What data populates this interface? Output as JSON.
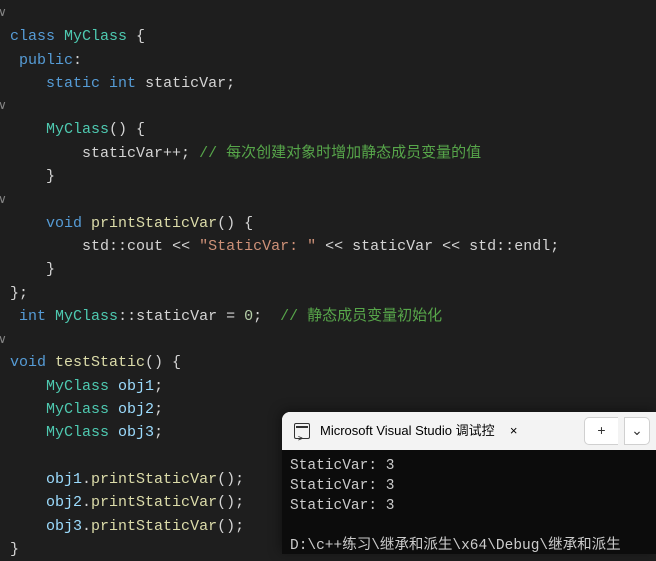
{
  "code": {
    "l1_kw1": "class",
    "l1_type": "MyClass",
    "l1_brace": " {",
    "l2_kw": "public",
    "l2_colon": ":",
    "l3_kw1": "static",
    "l3_kw2": "int",
    "l3_var": "staticVar",
    "l3_semi": ";",
    "l5_type": "MyClass",
    "l5_parens": "() {",
    "l6_var": "staticVar",
    "l6_op": "++;",
    "l6_cmt": "// 每次创建对象时增加静态成员变量的值",
    "l7_brace": "}",
    "l9_kw": "void",
    "l9_fn": "printStaticVar",
    "l9_parens": "() {",
    "l10_ns": "std",
    "l10_scope1": "::",
    "l10_cout": "cout",
    "l10_op1": " << ",
    "l10_str": "\"StaticVar: \"",
    "l10_op2": " << ",
    "l10_var": "staticVar",
    "l10_op3": " << ",
    "l10_ns2": "std",
    "l10_scope2": "::",
    "l10_endl": "endl",
    "l10_semi": ";",
    "l11_brace": "}",
    "l12_close": "};",
    "l13_kw": "int",
    "l13_type": "MyClass",
    "l13_scope": "::",
    "l13_var": "staticVar",
    "l13_eq": " = ",
    "l13_num": "0",
    "l13_semi": ";",
    "l13_cmt": "// 静态成员变量初始化",
    "l15_kw": "void",
    "l15_fn": "testStatic",
    "l15_parens": "() {",
    "l16_type": "MyClass",
    "l16_var": "obj1",
    "l16_semi": ";",
    "l17_type": "MyClass",
    "l17_var": "obj2",
    "l17_semi": ";",
    "l18_type": "MyClass",
    "l18_var": "obj3",
    "l18_semi": ";",
    "l20_var": "obj1",
    "l20_dot": ".",
    "l20_fn": "printStaticVar",
    "l20_call": "();",
    "l21_var": "obj2",
    "l21_dot": ".",
    "l21_fn": "printStaticVar",
    "l21_call": "();",
    "l22_var": "obj3",
    "l22_dot": ".",
    "l22_fn": "printStaticVar",
    "l22_call": "();",
    "l23_brace": "}"
  },
  "folds": {
    "f1": "∨",
    "f5": "∨",
    "f9": "∨",
    "f15": "∨"
  },
  "console": {
    "title": "Microsoft Visual Studio 调试控",
    "close": "×",
    "add": "+",
    "drop": "⌄",
    "lines": [
      "StaticVar: 3",
      "StaticVar: 3",
      "StaticVar: 3",
      "",
      "D:\\c++练习\\继承和派生\\x64\\Debug\\继承和派生"
    ]
  }
}
